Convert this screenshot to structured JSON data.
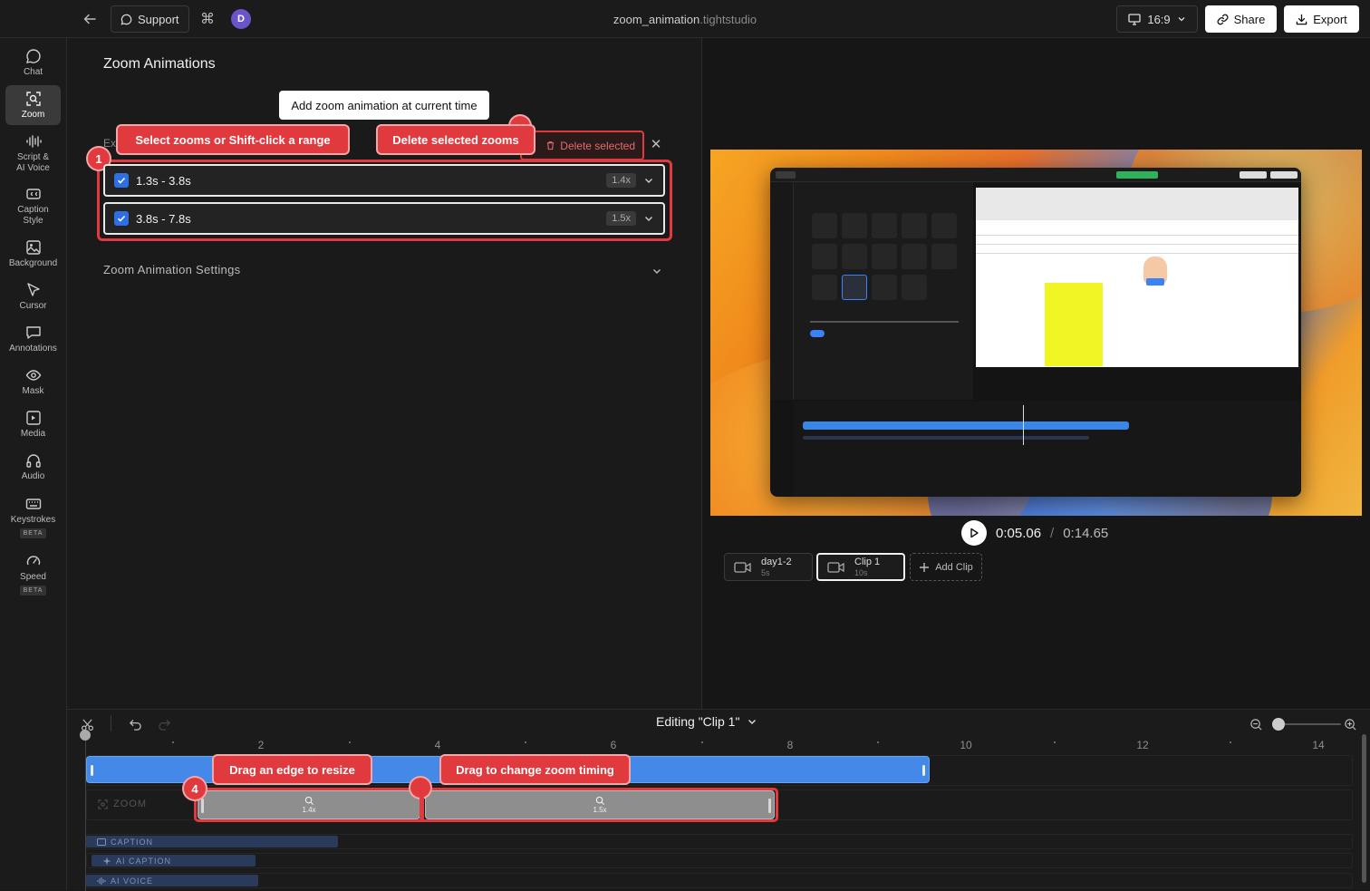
{
  "topbar": {
    "support_label": "Support",
    "avatar_initial": "D",
    "title_name": "zoom_animation",
    "title_ext": ".tightstudio",
    "aspect_ratio": "16:9",
    "share_label": "Share",
    "export_label": "Export"
  },
  "sidebar": {
    "items": [
      {
        "label": "Chat",
        "icon": "chat-icon"
      },
      {
        "label": "Zoom",
        "icon": "zoom-icon",
        "active": true
      },
      {
        "label": "Script &\nAI Voice",
        "icon": "waveform-icon"
      },
      {
        "label": "Caption\nStyle",
        "icon": "caption-icon"
      },
      {
        "label": "Background",
        "icon": "image-icon"
      },
      {
        "label": "Cursor",
        "icon": "cursor-icon"
      },
      {
        "label": "Annotations",
        "icon": "annotation-icon"
      },
      {
        "label": "Mask",
        "icon": "eye-icon"
      },
      {
        "label": "Media",
        "icon": "media-icon"
      },
      {
        "label": "Audio",
        "icon": "headphones-icon"
      },
      {
        "label": "Keystrokes",
        "icon": "keyboard-icon",
        "badge": "BETA"
      },
      {
        "label": "Speed",
        "icon": "speedometer-icon",
        "badge": "BETA"
      }
    ]
  },
  "panel": {
    "title": "Zoom Animations",
    "add_button": "Add zoom animation at current time",
    "ex_text": "Ex",
    "tooltip_select": "Select zooms or Shift-click a range",
    "tooltip_delete": "Delete selected zooms",
    "delete_button": "Delete selected",
    "badge_1": "1",
    "zoom_items": [
      {
        "range": "1.3s - 3.8s",
        "scale": "1.4x",
        "checked": true
      },
      {
        "range": "3.8s - 7.8s",
        "scale": "1.5x",
        "checked": true
      }
    ],
    "settings_label": "Zoom Animation Settings"
  },
  "preview": {
    "current_time": "0:05.06",
    "separator": "/",
    "total_time": "0:14.65",
    "clips": [
      {
        "name": "day1-2",
        "duration": "5s",
        "active": false
      },
      {
        "name": "Clip 1",
        "duration": "10s",
        "active": true
      }
    ],
    "add_clip_label": "Add Clip"
  },
  "timeline": {
    "editing_label": "Editing \"Clip 1\"",
    "ruler_labels": [
      "2",
      "4",
      "6",
      "8",
      "10",
      "12",
      "14"
    ],
    "zoom_track_label": "ZOOM",
    "zoom_segments": [
      {
        "scale": "1.4x"
      },
      {
        "scale": "1.5x"
      }
    ],
    "tooltip_edge": "Drag an edge to resize",
    "tooltip_timing": "Drag to change zoom timing",
    "badge_4": "4",
    "tracks": [
      {
        "label": "CAPTION"
      },
      {
        "label": "AI CAPTION"
      },
      {
        "label": "AI VOICE"
      }
    ]
  },
  "colors": {
    "accent_red": "#e0393e",
    "clip_blue": "#4489e8",
    "checkbox_blue": "#2f6fe4",
    "avatar_purple": "#6b54c9"
  }
}
